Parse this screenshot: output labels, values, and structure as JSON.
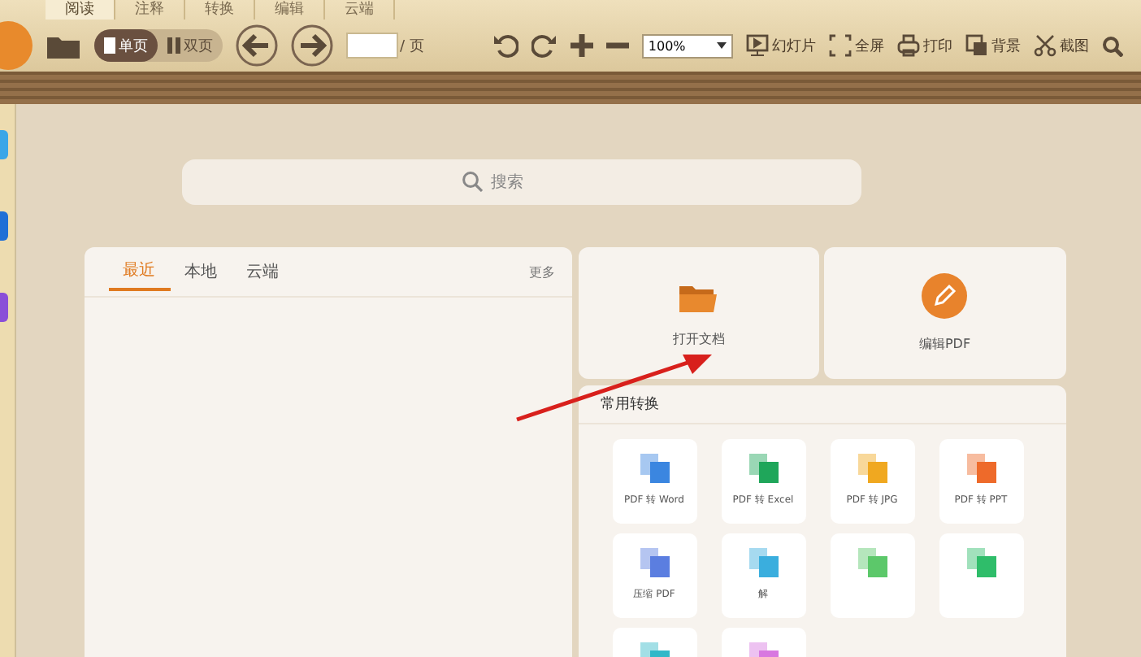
{
  "menu_tabs": [
    {
      "label": "阅读",
      "selected": true
    },
    {
      "label": "注释",
      "selected": false
    },
    {
      "label": "转换",
      "selected": false
    },
    {
      "label": "编辑",
      "selected": false
    },
    {
      "label": "云端",
      "selected": false
    }
  ],
  "toolbar": {
    "view_modes": [
      {
        "label": "单页",
        "selected": true
      },
      {
        "label": "双页",
        "selected": false
      }
    ],
    "page_suffix": "/ 页",
    "zoom": "100%",
    "actions": [
      {
        "label": "幻灯片",
        "kind": "slides"
      },
      {
        "label": "全屏",
        "kind": "fullscreen"
      },
      {
        "label": "打印",
        "kind": "print"
      },
      {
        "label": "背景",
        "kind": "background"
      },
      {
        "label": "截图",
        "kind": "screenshot"
      }
    ]
  },
  "sidebar": {
    "items": [
      {
        "color": "#3aa6e8"
      },
      {
        "color": "#1f6fd6"
      },
      {
        "color": "#8a4fd8"
      }
    ]
  },
  "search": {
    "placeholder": "搜索"
  },
  "recent_panel": {
    "tabs": [
      {
        "label": "最近",
        "selected": true
      },
      {
        "label": "本地",
        "selected": false
      },
      {
        "label": "云端",
        "selected": false
      }
    ],
    "more": "更多"
  },
  "quick_actions": [
    {
      "label": "打开文档",
      "kind": "open"
    },
    {
      "label": "编辑PDF",
      "kind": "edit"
    }
  ],
  "conversions": {
    "title": "常用转换",
    "tiles": [
      {
        "label": "PDF 转 Word",
        "color": "#3b86e0"
      },
      {
        "label": "PDF 转 Excel",
        "color": "#1fa65a"
      },
      {
        "label": "PDF 转 JPG",
        "color": "#f0a820"
      },
      {
        "label": "PDF 转 PPT",
        "color": "#ee6a2a"
      },
      {
        "label": "压缩 PDF",
        "color": "#5b7ee0"
      },
      {
        "label": "解",
        "color": "#3aaede"
      },
      {
        "color": "#5cc86a"
      },
      {
        "color": "#2fbd6a"
      },
      {
        "color": "#30b8c8"
      },
      {
        "color": "#d878e0"
      }
    ]
  },
  "annotation": {
    "kind": "arrow"
  }
}
